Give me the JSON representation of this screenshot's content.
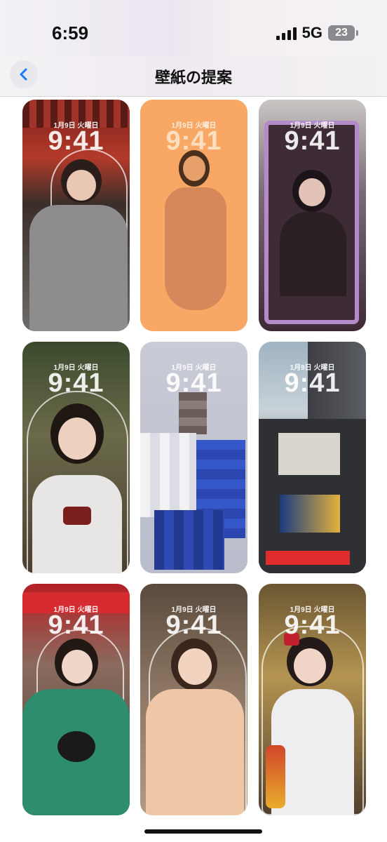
{
  "status": {
    "time": "6:59",
    "network": "5G",
    "battery": "23"
  },
  "nav": {
    "title": "壁紙の提案",
    "back_icon": "chevron-left-icon"
  },
  "wallpapers": [
    {
      "date": "1月9日 火曜日",
      "time": "9:41"
    },
    {
      "date": "1月9日 火曜日",
      "time": "9:41"
    },
    {
      "date": "1月9日 火曜日",
      "time": "9:41"
    },
    {
      "date": "1月9日 火曜日",
      "time": "9:41"
    },
    {
      "date": "1月9日 火曜日",
      "time": "9:41"
    },
    {
      "date": "1月9日 火曜日",
      "time": "9:41"
    },
    {
      "date": "1月9日 火曜日",
      "time": "9:41"
    },
    {
      "date": "1月9日 火曜日",
      "time": "9:41"
    },
    {
      "date": "1月9日 火曜日",
      "time": "9:41"
    }
  ],
  "colors": {
    "accent": "#1a7cf5"
  }
}
